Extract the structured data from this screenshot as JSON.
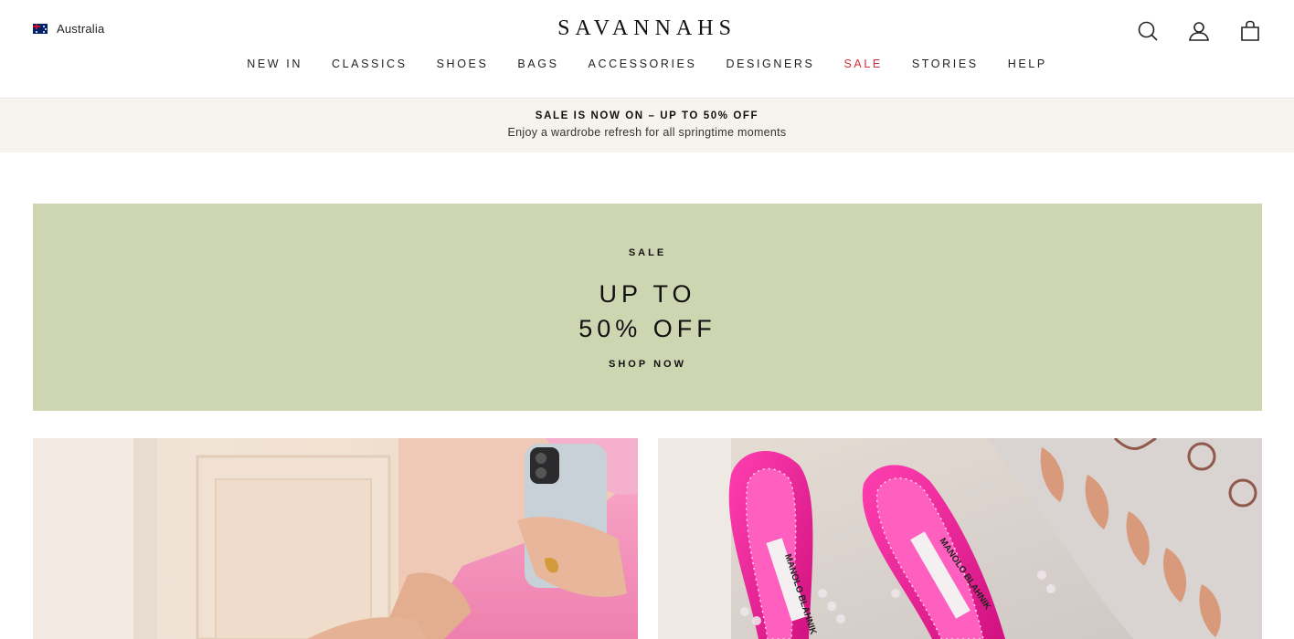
{
  "header": {
    "country": "Australia",
    "logo": "SAVANNAHS",
    "icons": [
      "search-icon",
      "account-icon",
      "bag-icon"
    ]
  },
  "nav": {
    "items": [
      "NEW IN",
      "CLASSICS",
      "SHOES",
      "BAGS",
      "ACCESSORIES",
      "DESIGNERS",
      "SALE",
      "STORIES",
      "HELP"
    ]
  },
  "promo": {
    "title": "SALE IS NOW ON – UP TO 50% OFF",
    "subtitle": "Enjoy a wardrobe refresh for all springtime moments"
  },
  "hero": {
    "eyebrow": "SALE",
    "headline_line1": "UP TO",
    "headline_line2": "50% OFF",
    "cta": "SHOP NOW"
  },
  "tiles": {
    "right_brand_text": "MANOLO BLAHNIK"
  },
  "colors": {
    "hero_bg": "#ced6b1",
    "promo_bg": "#f6f2ec",
    "sale_red": "#d1303a"
  }
}
